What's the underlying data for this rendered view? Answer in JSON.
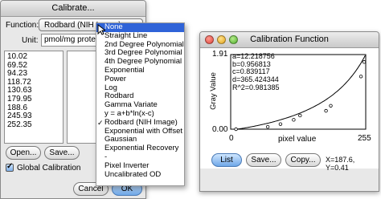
{
  "calibrate": {
    "title": "Calibrate...",
    "function_label": "Function:",
    "function_value": "Rodbard (NIH Image)",
    "unit_label": "Unit:",
    "unit_value": "pmol/mg protein",
    "measured_values": [
      "10.02",
      "69.52",
      "94.23",
      "118.72",
      "130.63",
      "179.95",
      "188.6",
      "245.93",
      "252.35"
    ],
    "open_label": "Open...",
    "save_label": "Save...",
    "global_label": "Global Calibration",
    "cancel_label": "Cancel",
    "ok_label": "OK"
  },
  "menu": {
    "items": [
      {
        "label": "None",
        "highlighted": true
      },
      {
        "label": "Straight Line"
      },
      {
        "label": "2nd Degree Polynomial"
      },
      {
        "label": "3rd Degree Polynomial"
      },
      {
        "label": "4th Degree Polynomial"
      },
      {
        "label": "Exponential"
      },
      {
        "label": "Power"
      },
      {
        "label": "Log"
      },
      {
        "label": "Rodbard"
      },
      {
        "label": "Gamma Variate"
      },
      {
        "label": "y = a+b*ln(x-c)"
      },
      {
        "label": "Rodbard (NIH Image)",
        "checked": true
      },
      {
        "label": "Exponential with Offset"
      },
      {
        "label": "Gaussian"
      },
      {
        "label": "Exponential Recovery"
      },
      {
        "label": "-"
      },
      {
        "label": "Pixel Inverter"
      },
      {
        "label": "Uncalibrated OD"
      }
    ]
  },
  "calfunc": {
    "title": "Calibration Function",
    "ymax_label": "1.91",
    "ymin_label": "0.00",
    "xmin_label": "0",
    "xmax_label": "255",
    "xlabel": "pixel value",
    "ylabel": "Gray Value",
    "params": [
      "a=12.218756",
      "b=0.956813",
      "c=0.839117",
      "d=365.424344",
      "R^2=0.981385"
    ],
    "list_label": "List",
    "save_label": "Save...",
    "copy_label": "Copy...",
    "coords": "X=187.6, Y=0.41"
  },
  "chart_data": {
    "type": "scatter",
    "xlabel": "pixel value",
    "ylabel": "Gray Value",
    "xlim": [
      0,
      255
    ],
    "ylim": [
      0,
      1.91
    ],
    "points": [
      {
        "x": 10,
        "y": 0.0
      },
      {
        "x": 70,
        "y": 0.06
      },
      {
        "x": 94,
        "y": 0.13
      },
      {
        "x": 119,
        "y": 0.24
      },
      {
        "x": 131,
        "y": 0.35
      },
      {
        "x": 180,
        "y": 0.47
      },
      {
        "x": 189,
        "y": 0.6
      },
      {
        "x": 246,
        "y": 1.35
      },
      {
        "x": 252,
        "y": 1.72
      }
    ],
    "curve": {
      "a": 12.218756,
      "b": 0.956813,
      "c": 0.839117,
      "d": 365.424344
    }
  }
}
